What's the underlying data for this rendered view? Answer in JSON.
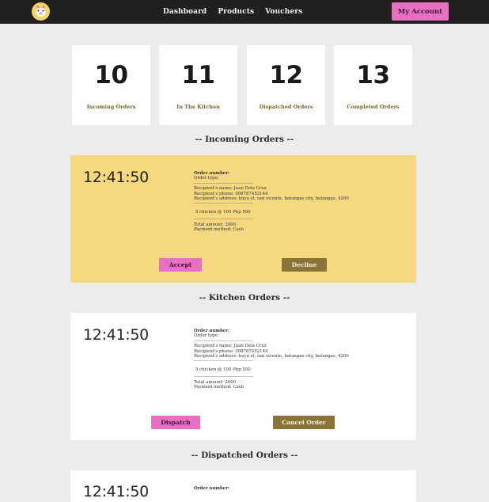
{
  "nav": {
    "links": [
      "Dashboard",
      "Products",
      "Vouchers"
    ],
    "account_label": "My Account"
  },
  "stats": [
    {
      "value": "10",
      "label": "Incoming Orders"
    },
    {
      "value": "11",
      "label": "In The Kitchen"
    },
    {
      "value": "12",
      "label": "Dispatched Orders"
    },
    {
      "value": "13",
      "label": "Completed Orders"
    }
  ],
  "sections": {
    "incoming": "-- Incoming Orders --",
    "kitchen": "-- Kitchen Orders --",
    "dispatched": "-- Dispatched Orders --"
  },
  "order": {
    "time": "12:41:50",
    "number_label": "Order number:",
    "type_label": "Order type:",
    "dashes": "-----------------------------------------",
    "recipient_name": "Recipient's name: Juan Dela Cruz",
    "recipient_phone": "Recipient's phone: 098787452144",
    "recipient_address": "Recipient's address: kuya st, san vicente, batangas city, batangas, 4200",
    "item": "5  chicken  @  100  Php 500",
    "total": "Total amount: 2000",
    "payment": "Payment method: Cash",
    "number_label_partial": "Order number:"
  },
  "buttons": {
    "accept": "Accept",
    "decline": "Decline",
    "dispatch": "Dispatch",
    "cancel": "Cancel Order"
  },
  "colors": {
    "topbar": "#211f1f",
    "accent_pink": "#e86fc1",
    "accent_olive": "#8b7438",
    "incoming_card": "#f5d880"
  }
}
